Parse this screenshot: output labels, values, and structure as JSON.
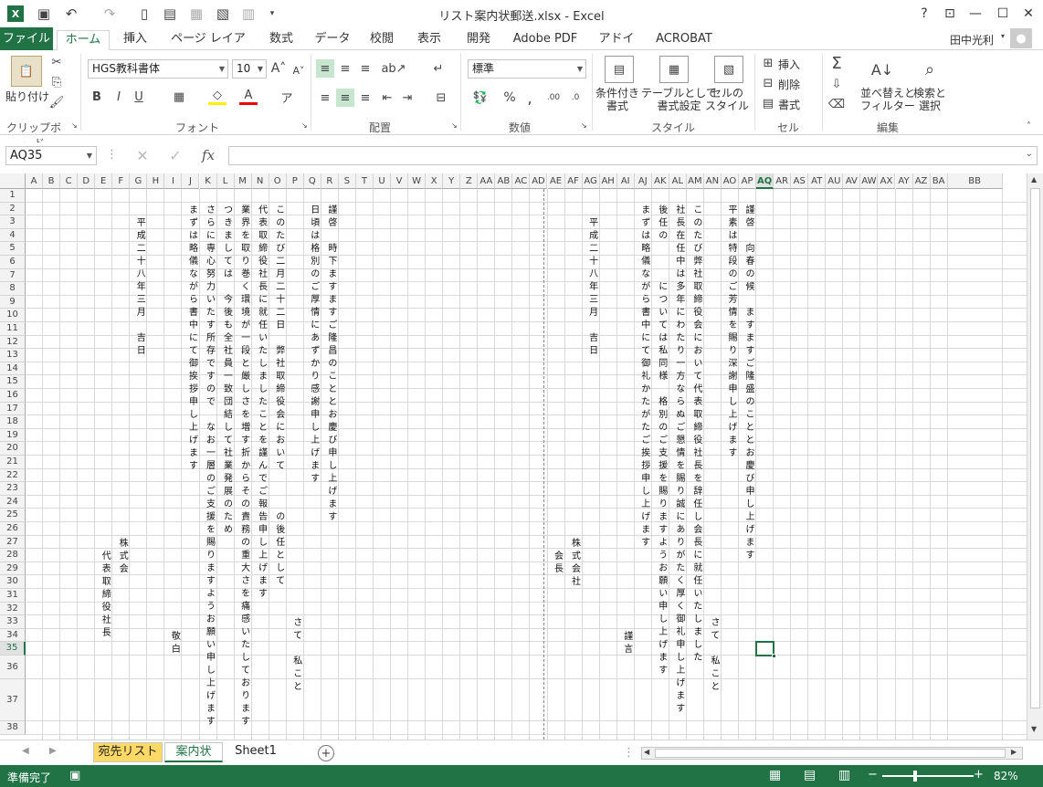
{
  "window": {
    "title": "リスト案内状郵送.xlsx - Excel",
    "user": "田中光利"
  },
  "ribbon_tabs": [
    "ファイル",
    "ホーム",
    "挿入",
    "ページ レイアウト",
    "数式",
    "データ",
    "校閲",
    "表示",
    "開発",
    "Adobe PDF",
    "アドイン",
    "ACROBAT"
  ],
  "ribbon": {
    "clipboard": {
      "label": "クリップボード",
      "paste": "貼り付け"
    },
    "font": {
      "label": "フォント",
      "name": "HGS教科書体",
      "size": "10",
      "bold": "B",
      "italic": "I",
      "underline": "U"
    },
    "alignment": {
      "label": "配置"
    },
    "number": {
      "label": "数値",
      "format": "標準"
    },
    "styles": {
      "label": "スタイル",
      "cond": "条件付き\n書式",
      "table": "テーブルとして\n書式設定",
      "cell": "セルの\nスタイル"
    },
    "cells": {
      "label": "セル",
      "insert": "挿入",
      "delete": "削除",
      "format": "書式"
    },
    "editing": {
      "label": "編集",
      "sort": "並べ替えと\nフィルター",
      "find": "検索と\n選択"
    }
  },
  "formula_bar": {
    "name_box": "AQ35",
    "fx": "fx",
    "value": ""
  },
  "columns": [
    "A",
    "B",
    "C",
    "D",
    "E",
    "F",
    "G",
    "H",
    "I",
    "J",
    "K",
    "L",
    "M",
    "N",
    "O",
    "P",
    "Q",
    "R",
    "S",
    "T",
    "U",
    "V",
    "W",
    "X",
    "Y",
    "Z",
    "AA",
    "AB",
    "AC",
    "AD",
    "AE",
    "AF",
    "AG",
    "AH",
    "AI",
    "AJ",
    "AK",
    "AL",
    "AM",
    "AN",
    "AO",
    "AP",
    "AQ",
    "AR",
    "AS",
    "AT",
    "AU",
    "AV",
    "AW",
    "AX",
    "AY",
    "AZ",
    "BA",
    "BB"
  ],
  "rows": [
    "1",
    "2",
    "3",
    "4",
    "5",
    "6",
    "7",
    "8",
    "9",
    "10",
    "11",
    "12",
    "13",
    "14",
    "15",
    "16",
    "17",
    "18",
    "19",
    "20",
    "21",
    "22",
    "23",
    "24",
    "25",
    "26",
    "27",
    "28",
    "29",
    "30",
    "31",
    "32",
    "33",
    "34",
    "35",
    "36",
    "37",
    "38"
  ],
  "letter_left": {
    "R": "謹啓　時下ますますご隆昌のこととお慶び申し上げます",
    "Q": "日頃は格別のご厚情にあずかり感謝申し上げます",
    "O": "このたび二月二十二日　弊社取締役会において　　　の後任として",
    "N": "代表取締役社長に就任いたしましたことを謹んでご報告申し上げます",
    "M": "業界を取り巻く環境が一段と厳しさを増す折からその責務の重大さを痛感いたしております",
    "L": "つきましては　今後も全社員一致団結して社業発展のため",
    "K": "さらに専心努力いたす所存ですので　なお一層のご支援を賜りますようお願い申し上げます",
    "J": "まずは略儀ながら書中にて御挨拶申し上げます",
    "G": "平成二十八年三月　吉日",
    "F": "株式会",
    "E": "代表取締役社長",
    "I": "敬白",
    "P": "さて　私こと"
  },
  "letter_right": {
    "AP": "謹啓　向春の候　ますますご隆盛のこととお慶び申し上げます",
    "AO": "平素は特段のご芳情を賜り深謝申し上げます",
    "AM": "このたび弊社取締役会において代表取締役社長を辞任し会長に就任いたしました",
    "AL": "社長在任中は多年にわたり一方ならぬご懇情を賜り誠にありがたく厚く御礼申し上げます",
    "AK": "後任の　　　については私同様　格別のご支援を賜りますようお願い申し上げます",
    "AJ": "まずは略儀ながら書中にて御礼かたがたご挨拶申し上げます",
    "AG": "平成二十八年三月　吉日",
    "AF": "株式会社",
    "AE": "会長",
    "AI": "謹言",
    "AN": "さて　私こと"
  },
  "sheets": [
    "宛先リスト",
    "案内状",
    "Sheet1"
  ],
  "status": {
    "ready": "準備完了",
    "zoom": "82%"
  }
}
